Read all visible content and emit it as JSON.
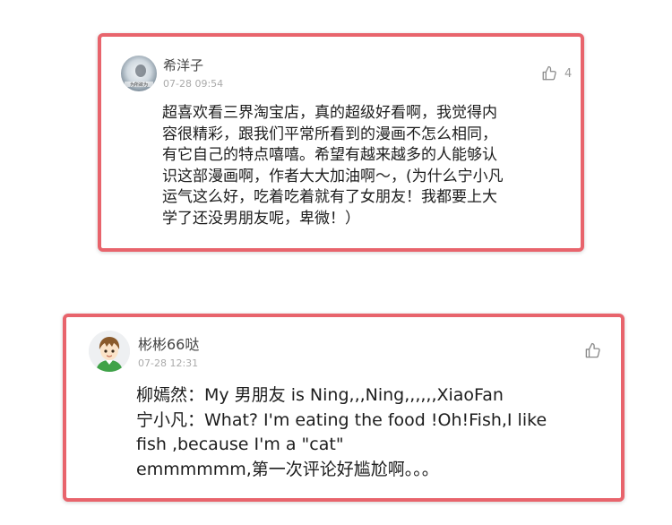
{
  "comments": [
    {
      "username": "希洋子",
      "time": "07-28 09:54",
      "likes": "4",
      "avatar_text": "为所欲为",
      "text": "超喜欢看三界淘宝店，真的超级好看啊，我觉得内\n容很精彩，跟我们平常所看到的漫画不怎么相同，\n有它自己的特点嘻嘻。希望有越来越多的人能够认\n识这部漫画啊，作者大大加油啊～，(为什么宁小凡\n运气这么好，吃着吃着就有了女朋友！我都要上大\n学了还没男朋友呢，卑微！）",
      "avatar_icon": "blurred-portrait",
      "like_icon": "thumbs-up-icon"
    },
    {
      "username": "彬彬66哒",
      "time": "07-28 12:31",
      "likes": "",
      "text": "柳嫣然：My 男朋友 is Ning,,,Ning,,,,,,XiaoFan\n宁小凡：What? I'm eating the food !Oh!Fish,I like\nfish ,because I'm a \"cat\"\nemmmmmm,第一次评论好尴尬啊。。。",
      "avatar_icon": "cartoon-boy-avatar",
      "like_icon": "thumbs-up-icon"
    }
  ],
  "colors": {
    "highlight_border": "#e8646c",
    "username": "#444444",
    "meta": "#aaaaaa",
    "body_text": "#1d1d1d"
  }
}
